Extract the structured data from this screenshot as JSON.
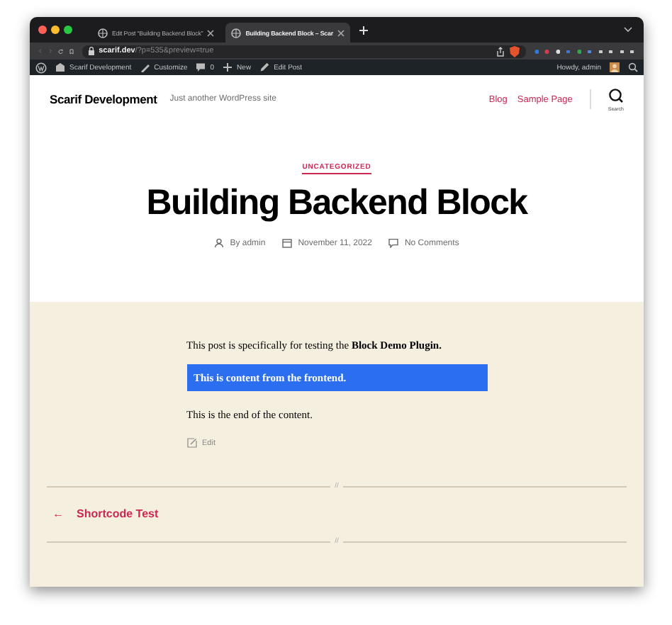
{
  "browser": {
    "tabs": [
      {
        "label": "Edit Post “Building Backend Block”",
        "selected": false
      },
      {
        "label": "Building Backend Block – Scar",
        "selected": true
      }
    ],
    "url": {
      "host": "scarif.dev",
      "path": "/?p=535&preview=true"
    }
  },
  "admin_bar": {
    "items": [
      {
        "kind": "site",
        "label": "Scarif Development"
      },
      {
        "kind": "customize",
        "label": "Customize"
      },
      {
        "kind": "comments",
        "label": "0"
      },
      {
        "kind": "new",
        "label": "New"
      },
      {
        "kind": "edit",
        "label": "Edit Post"
      }
    ],
    "greeting": "Howdy, admin"
  },
  "site_header": {
    "title": "Scarif Development",
    "tagline": "Just another WordPress site",
    "menu": [
      "Blog",
      "Sample Page"
    ],
    "search_label": "Search"
  },
  "post": {
    "category": "UNCATEGORIZED",
    "title": "Building Backend Block",
    "meta": [
      {
        "kind": "author",
        "label": "By admin"
      },
      {
        "kind": "date",
        "label": "November 11, 2022"
      },
      {
        "kind": "comments",
        "label": "No Comments"
      }
    ],
    "content": [
      {
        "kind": "paragraph",
        "text": "This post is specifically for testing the **Block Demo Plugin.**"
      },
      {
        "kind": "highlight",
        "text": "This is content from the frontend."
      },
      {
        "kind": "paragraph",
        "text": "This is the end of the content."
      }
    ],
    "edit_link": "Edit"
  },
  "separators": [
    "//",
    "//"
  ],
  "navigation": {
    "previous": "Shortcode Test",
    "arrow": "←"
  }
}
